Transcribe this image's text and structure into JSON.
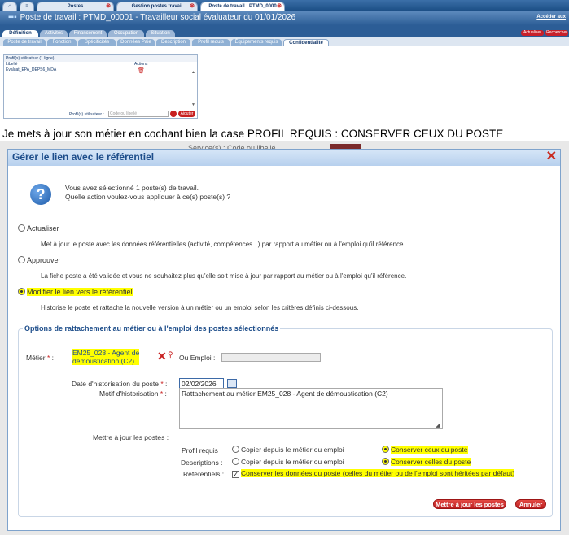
{
  "top_tabs": [
    {
      "label": "Postes"
    },
    {
      "label": "Gestion postes travail"
    },
    {
      "label": "Poste de travail : PTMD_0000"
    }
  ],
  "window_title": "Poste de travail : PTMD_00001 - Travailleur social évaluateur du 01/01/2026",
  "top_link": "Accéder aux",
  "main_tabs": [
    {
      "label": "Définition"
    },
    {
      "label": "Activités"
    },
    {
      "label": "Financement"
    },
    {
      "label": "Occupation"
    },
    {
      "label": "Situation"
    }
  ],
  "top_buttons": {
    "refresh": "Actualiser",
    "search": "Rechercher"
  },
  "sub_tabs": [
    {
      "label": "Poste de travail"
    },
    {
      "label": "Fonction"
    },
    {
      "label": "Spécificités"
    },
    {
      "label": "Données Paie"
    },
    {
      "label": "Description"
    },
    {
      "label": "Profil requis"
    },
    {
      "label": "Équipements requis"
    },
    {
      "label": "Confidentialité"
    }
  ],
  "profiles_grid": {
    "caption": "Profil(s) utilisateur (1 ligne)",
    "col_label": "Libellé",
    "col_actions": "Actions",
    "rows": [
      {
        "label": "Evaluat_EPA_DEPS6_MDA"
      }
    ],
    "footer_label": "Profil(s) utilisateur :",
    "footer_placeholder": "Code ou libellé",
    "add_button": "Ajouter"
  },
  "caption_text": "Je mets à jour son métier en cochant bien la case PROFIL REQUIS : CONSERVER CEUX DU POSTE",
  "background_hint": "Service(s) : Code ou libellé",
  "dialog": {
    "title": "Gérer le lien avec le référentiel",
    "question_line1": "Vous avez sélectionné 1 poste(s) de travail.",
    "question_line2": "Quelle action voulez-vous appliquer à ce(s) poste(s) ?",
    "options": [
      {
        "label": "Actualiser",
        "desc": "Met à jour le poste avec les données référentielles (activité, compétences...) par rapport au métier ou à l'emploi qu'il référence.",
        "selected": false
      },
      {
        "label": "Approuver",
        "desc": "La fiche poste a été validée et vous ne souhaitez plus qu'elle soit mise à jour par rapport au métier ou à l'emploi qu'il référence.",
        "selected": false
      },
      {
        "label": "Modifier le lien vers le référentiel",
        "desc": "Historise le poste et rattache la nouvelle version à un métier ou un emploi selon les critères définis ci-dessous.",
        "selected": true
      }
    ],
    "fieldset_legend": "Options de rattachement au métier ou à l'emploi des postes sélectionnés",
    "metier_label": "Métier",
    "metier_value_line1": "EM25_028 - Agent de",
    "metier_value_line2": "démoustication (C2)",
    "emploi_label": "Ou Emploi :",
    "date_label": "Date d'historisation du poste",
    "date_value": "02/02/2026",
    "motif_label": "Motif d'historisation",
    "motif_value": "Rattachement au métier EM25_028 - Agent de démoustication (C2)",
    "update_label": "Mettre à jour les postes :",
    "profil_label": "Profil requis :",
    "profil_opt1": "Copier depuis le métier ou emploi",
    "profil_opt2": "Conserver ceux du poste",
    "desc_label": "Descriptions :",
    "desc_opt1": "Copier depuis le métier ou emploi",
    "desc_opt2": "Conserver celles du poste",
    "ref_label": "Référentiels :",
    "ref_checkbox": "Conserver les données du poste (celles du métier ou de l'emploi sont héritées par défaut)",
    "ref_checked": true,
    "btn_update": "Mettre à jour les postes",
    "btn_cancel": "Annuler"
  },
  "colors": {
    "accent": "#1d4d8a",
    "highlight": "#ffff00",
    "danger": "#c8202a"
  }
}
